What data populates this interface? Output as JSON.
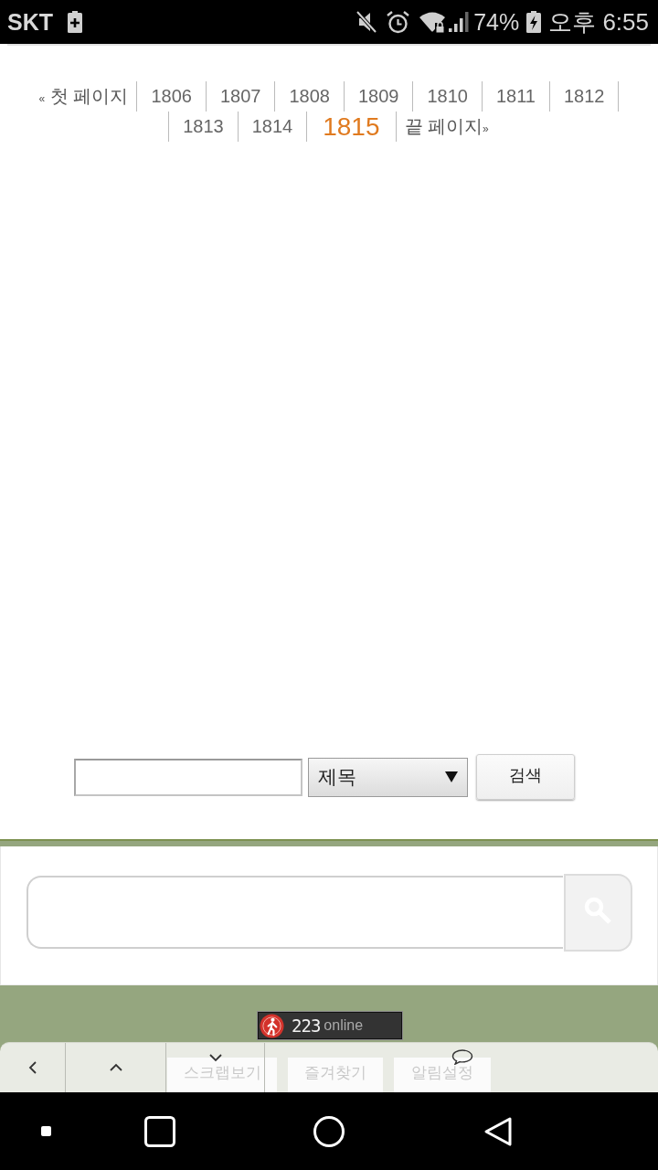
{
  "status_bar": {
    "carrier": "SKT",
    "battery": "74%",
    "time": "오후 6:55"
  },
  "pagination": {
    "first": {
      "mark": "«",
      "label": "첫 페이지"
    },
    "pages": [
      {
        "label": "1806",
        "selected": false
      },
      {
        "label": "1807",
        "selected": false
      },
      {
        "label": "1808",
        "selected": false
      },
      {
        "label": "1809",
        "selected": false
      },
      {
        "label": "1810",
        "selected": false
      },
      {
        "label": "1811",
        "selected": false
      },
      {
        "label": "1812",
        "selected": false
      },
      {
        "label": "1813",
        "selected": false
      },
      {
        "label": "1814",
        "selected": false
      },
      {
        "label": "1815",
        "selected": true
      }
    ],
    "last": {
      "label": "끝 페이지",
      "mark": "»"
    }
  },
  "board_search": {
    "field_option": "제목",
    "button": "검색"
  },
  "online_counter": {
    "count": "223",
    "label": "online"
  },
  "bottom_toolbar": {
    "menu": [
      "스크랩보기",
      "즐겨찾기",
      "알림설정"
    ]
  }
}
